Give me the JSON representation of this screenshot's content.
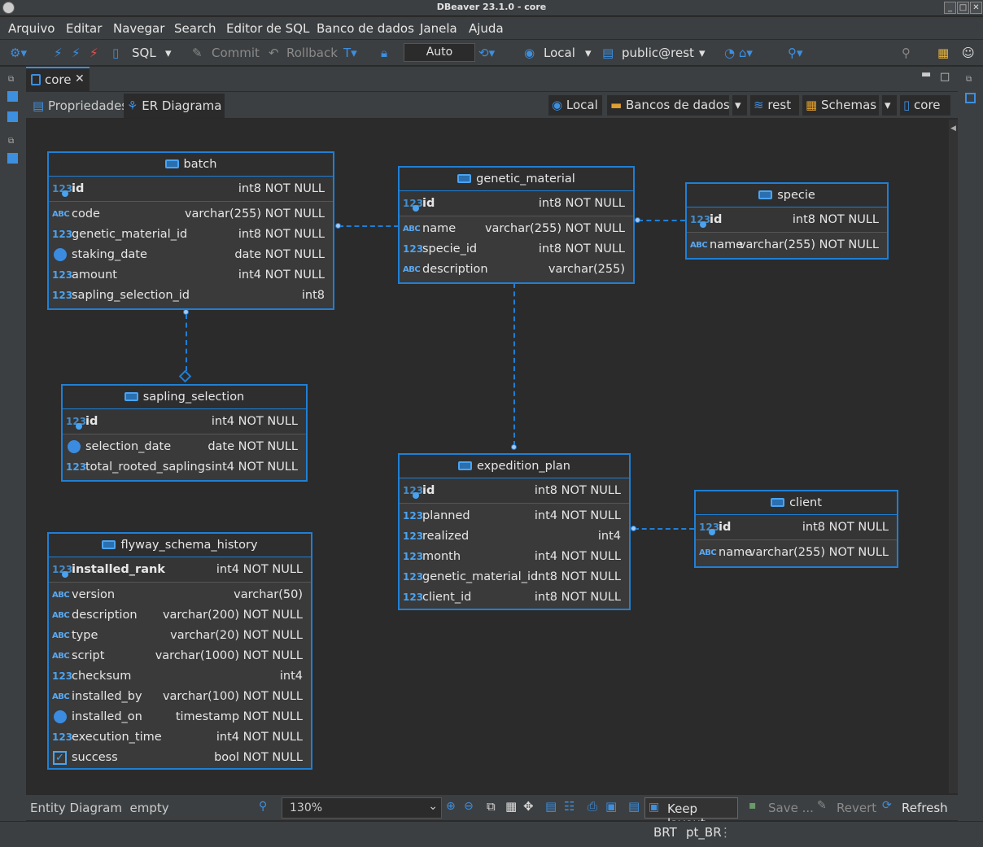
{
  "window": {
    "title": "DBeaver 23.1.0 - core"
  },
  "menu": [
    "Arquivo",
    "Editar",
    "Navegar",
    "Search",
    "Editor de SQL",
    "Banco de dados",
    "Janela",
    "Ajuda"
  ],
  "toolbar": {
    "sql": "SQL",
    "commit": "Commit",
    "rollback": "Rollback",
    "mode": "Auto",
    "datasource": "Local",
    "schema": "public@rest"
  },
  "editor_tab": {
    "label": "core"
  },
  "subtabs": {
    "properties": "Propriedades",
    "er": "ER Diagrama"
  },
  "breadcrumb": [
    "Local",
    "Bancos de dados",
    "rest",
    "Schemas",
    "core"
  ],
  "entities": {
    "batch": {
      "name": "batch",
      "pk": {
        "name": "id",
        "type": "int8 NOT NULL"
      },
      "cols": [
        {
          "i": "abc",
          "name": "code",
          "type": "varchar(255) NOT NULL"
        },
        {
          "i": "num",
          "name": "genetic_material_id",
          "type": "int8 NOT NULL"
        },
        {
          "i": "clk",
          "name": "staking_date",
          "type": "date NOT NULL"
        },
        {
          "i": "num",
          "name": "amount",
          "type": "int4 NOT NULL"
        },
        {
          "i": "num",
          "name": "sapling_selection_id",
          "type": "int8"
        }
      ]
    },
    "genetic_material": {
      "name": "genetic_material",
      "pk": {
        "name": "id",
        "type": "int8 NOT NULL"
      },
      "cols": [
        {
          "i": "abc",
          "name": "name",
          "type": "varchar(255) NOT NULL"
        },
        {
          "i": "num",
          "name": "specie_id",
          "type": "int8 NOT NULL"
        },
        {
          "i": "abc",
          "name": "description",
          "type": "varchar(255)"
        }
      ]
    },
    "specie": {
      "name": "specie",
      "pk": {
        "name": "id",
        "type": "int8 NOT NULL"
      },
      "cols": [
        {
          "i": "abc",
          "name": "name",
          "type": "varchar(255) NOT NULL"
        }
      ]
    },
    "sapling_selection": {
      "name": "sapling_selection",
      "pk": {
        "name": "id",
        "type": "int4 NOT NULL"
      },
      "cols": [
        {
          "i": "clk",
          "name": "selection_date",
          "type": "date NOT NULL"
        },
        {
          "i": "num",
          "name": "total_rooted_saplings",
          "type": "int4 NOT NULL"
        }
      ]
    },
    "expedition_plan": {
      "name": "expedition_plan",
      "pk": {
        "name": "id",
        "type": "int8 NOT NULL"
      },
      "cols": [
        {
          "i": "num",
          "name": "planned",
          "type": "int4 NOT NULL"
        },
        {
          "i": "num",
          "name": "realized",
          "type": "int4"
        },
        {
          "i": "num",
          "name": "month",
          "type": "int4 NOT NULL"
        },
        {
          "i": "num",
          "name": "genetic_material_id",
          "type": "int8 NOT NULL"
        },
        {
          "i": "num",
          "name": "client_id",
          "type": "int8 NOT NULL"
        }
      ]
    },
    "client": {
      "name": "client",
      "pk": {
        "name": "id",
        "type": "int8 NOT NULL"
      },
      "cols": [
        {
          "i": "abc",
          "name": "name",
          "type": "varchar(255) NOT NULL"
        }
      ]
    },
    "flyway_schema_history": {
      "name": "flyway_schema_history",
      "pk": {
        "name": "installed_rank",
        "type": "int4 NOT NULL"
      },
      "cols": [
        {
          "i": "abc",
          "name": "version",
          "type": "varchar(50)"
        },
        {
          "i": "abc",
          "name": "description",
          "type": "varchar(200) NOT NULL"
        },
        {
          "i": "abc",
          "name": "type",
          "type": "varchar(20) NOT NULL"
        },
        {
          "i": "abc",
          "name": "script",
          "type": "varchar(1000) NOT NULL"
        },
        {
          "i": "num",
          "name": "checksum",
          "type": "int4"
        },
        {
          "i": "abc",
          "name": "installed_by",
          "type": "varchar(100) NOT NULL"
        },
        {
          "i": "clk",
          "name": "installed_on",
          "type": "timestamp NOT NULL"
        },
        {
          "i": "num",
          "name": "execution_time",
          "type": "int4 NOT NULL"
        },
        {
          "i": "chk",
          "name": "success",
          "type": "bool NOT NULL"
        }
      ]
    }
  },
  "icons": {
    "num": "123",
    "abc": "ABC",
    "pk": "123"
  },
  "bottom": {
    "status": "Entity Diagram  empty",
    "zoom": "130%",
    "keep_layout": "Keep layout",
    "save": "Save ...",
    "revert": "Revert",
    "refresh": "Refresh"
  },
  "status": {
    "tz": "BRT",
    "locale": "pt_BR"
  }
}
